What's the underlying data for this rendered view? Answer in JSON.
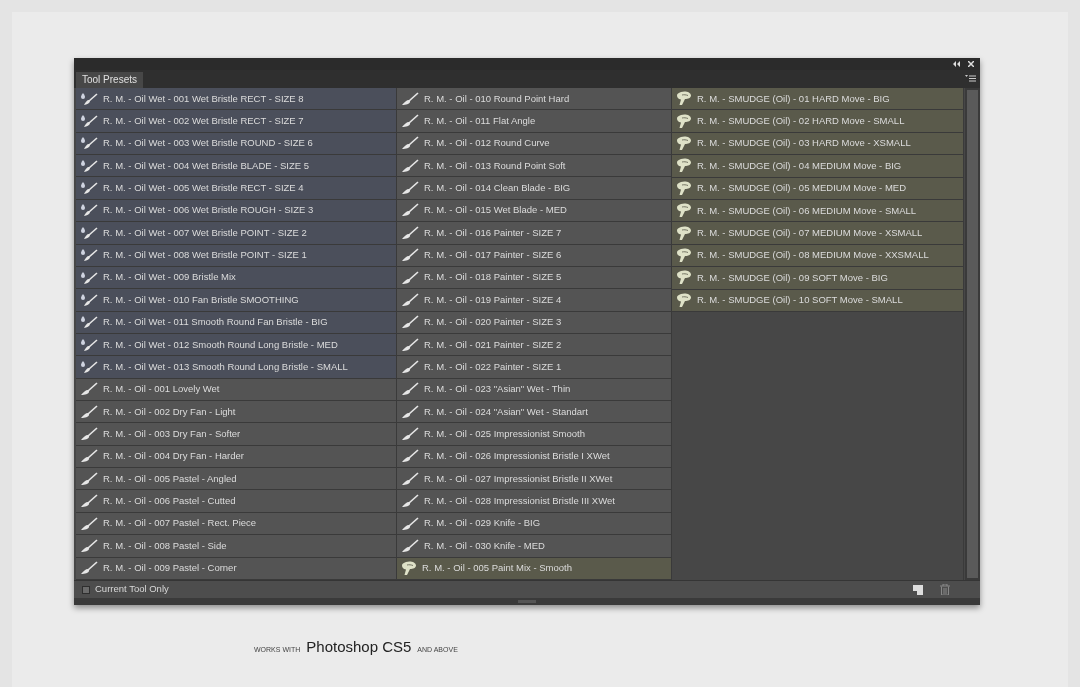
{
  "panel": {
    "tab": "Tool Presets",
    "selected": true
  },
  "columns": [
    [
      {
        "kind": "wet",
        "label": "R. M. - Oil Wet - 001 Wet Bristle RECT - SIZE 8"
      },
      {
        "kind": "wet",
        "label": "R. M. - Oil Wet - 002 Wet Bristle RECT - SIZE 7"
      },
      {
        "kind": "wet",
        "label": "R. M. - Oil Wet - 003 Wet Bristle ROUND - SIZE 6"
      },
      {
        "kind": "wet",
        "label": "R. M. - Oil Wet - 004 Wet Bristle BLADE - SIZE 5"
      },
      {
        "kind": "wet",
        "label": "R. M. - Oil Wet - 005 Wet Bristle RECT - SIZE 4"
      },
      {
        "kind": "wet",
        "label": "R. M. - Oil Wet - 006 Wet Bristle ROUGH - SIZE 3"
      },
      {
        "kind": "wet",
        "label": "R. M. - Oil Wet - 007 Wet Bristle POINT - SIZE 2"
      },
      {
        "kind": "wet",
        "label": "R. M. - Oil Wet - 008 Wet Bristle POINT - SIZE 1"
      },
      {
        "kind": "wet",
        "label": "R. M. - Oil Wet - 009 Bristle Mix"
      },
      {
        "kind": "wet",
        "label": "R. M. - Oil Wet - 010 Fan Bristle SMOOTHING"
      },
      {
        "kind": "wet",
        "label": "R. M. - Oil Wet - 011 Smooth Round Fan Bristle - BIG"
      },
      {
        "kind": "wet",
        "label": "R. M. - Oil Wet - 012 Smooth Round Long Bristle - MED"
      },
      {
        "kind": "wet",
        "label": "R. M. - Oil Wet - 013 Smooth Round Long Bristle - SMALL"
      },
      {
        "kind": "oil",
        "label": "R. M. - Oil - 001 Lovely Wet"
      },
      {
        "kind": "oil",
        "label": "R. M. - Oil - 002 Dry Fan - Light"
      },
      {
        "kind": "oil",
        "label": "R. M. - Oil - 003 Dry Fan - Softer"
      },
      {
        "kind": "oil",
        "label": "R. M. - Oil - 004 Dry Fan - Harder"
      },
      {
        "kind": "oil",
        "label": "R. M. - Oil - 005 Pastel - Angled"
      },
      {
        "kind": "oil",
        "label": "R. M. - Oil - 006 Pastel - Cutted"
      },
      {
        "kind": "oil",
        "label": "R. M. - Oil - 007 Pastel - Rect. Piece"
      },
      {
        "kind": "oil",
        "label": "R. M. - Oil - 008 Pastel - Side"
      },
      {
        "kind": "oil",
        "label": "R. M. - Oil - 009 Pastel - Corner"
      }
    ],
    [
      {
        "kind": "oil",
        "label": "R. M. - Oil - 010 Round Point Hard"
      },
      {
        "kind": "oil",
        "label": "R. M. - Oil - 011 Flat Angle"
      },
      {
        "kind": "oil",
        "label": "R. M. - Oil - 012 Round Curve"
      },
      {
        "kind": "oil",
        "label": "R. M. - Oil - 013 Round Point Soft"
      },
      {
        "kind": "oil",
        "label": "R. M. - Oil - 014 Clean Blade - BIG"
      },
      {
        "kind": "oil",
        "label": "R. M. - Oil - 015 Wet Blade - MED"
      },
      {
        "kind": "oil",
        "label": "R. M. - Oil - 016 Painter - SIZE 7"
      },
      {
        "kind": "oil",
        "label": "R. M. - Oil - 017 Painter - SIZE 6"
      },
      {
        "kind": "oil",
        "label": "R. M. - Oil - 018 Painter - SIZE 5"
      },
      {
        "kind": "oil",
        "label": "R. M. - Oil - 019 Painter - SIZE 4"
      },
      {
        "kind": "oil",
        "label": "R. M. - Oil - 020 Painter - SIZE 3"
      },
      {
        "kind": "oil",
        "label": "R. M. - Oil - 021 Painter - SIZE 2"
      },
      {
        "kind": "oil",
        "label": "R. M. - Oil - 022 Painter - SIZE 1"
      },
      {
        "kind": "oil",
        "label": "R. M. - Oil - 023 \"Asian\" Wet - Thin"
      },
      {
        "kind": "oil",
        "label": "R. M. - Oil - 024 \"Asian\" Wet - Standart"
      },
      {
        "kind": "oil",
        "label": "R. M. - Oil - 025 Impressionist Smooth"
      },
      {
        "kind": "oil",
        "label": "R. M. - Oil - 026 Impressionist Bristle I XWet"
      },
      {
        "kind": "oil",
        "label": "R. M. - Oil - 027 Impressionist Bristle II XWet"
      },
      {
        "kind": "oil",
        "label": "R. M. - Oil - 028 Impressionist Bristle III XWet"
      },
      {
        "kind": "oil",
        "label": "R. M. - Oil - 029 Knife - BIG"
      },
      {
        "kind": "oil",
        "label": "R. M. - Oil - 030 Knife - MED"
      },
      {
        "kind": "smudge",
        "label": "R. M. - Oil - 005 Paint Mix - Smooth"
      }
    ],
    [
      {
        "kind": "smudge",
        "label": "R. M. - SMUDGE (Oil) - 01 HARD Move - BIG"
      },
      {
        "kind": "smudge",
        "label": "R. M. - SMUDGE (Oil) - 02 HARD Move - SMALL"
      },
      {
        "kind": "smudge",
        "label": "R. M. - SMUDGE (Oil) - 03 HARD Move - XSMALL"
      },
      {
        "kind": "smudge",
        "label": "R. M. - SMUDGE (Oil) - 04 MEDIUM Move - BIG"
      },
      {
        "kind": "smudge",
        "label": "R. M. - SMUDGE (Oil) - 05 MEDIUM Move - MED"
      },
      {
        "kind": "smudge",
        "label": "R. M. - SMUDGE (Oil) - 06 MEDIUM Move - SMALL"
      },
      {
        "kind": "smudge",
        "label": "R. M. - SMUDGE (Oil) - 07 MEDIUM Move - XSMALL"
      },
      {
        "kind": "smudge",
        "label": "R. M. - SMUDGE (Oil) - 08 MEDIUM Move - XXSMALL"
      },
      {
        "kind": "smudge",
        "label": "R. M. - SMUDGE (Oil) - 09 SOFT Move - BIG"
      },
      {
        "kind": "smudge",
        "label": "R. M. - SMUDGE (Oil) - 10 SOFT Move - SMALL"
      }
    ]
  ],
  "current_tool_only": {
    "label": "Current Tool Only",
    "checked": false
  },
  "footer": {
    "prefix": "WORKS WITH",
    "product": "Photoshop CS5",
    "suffix": "AND ABOVE"
  }
}
